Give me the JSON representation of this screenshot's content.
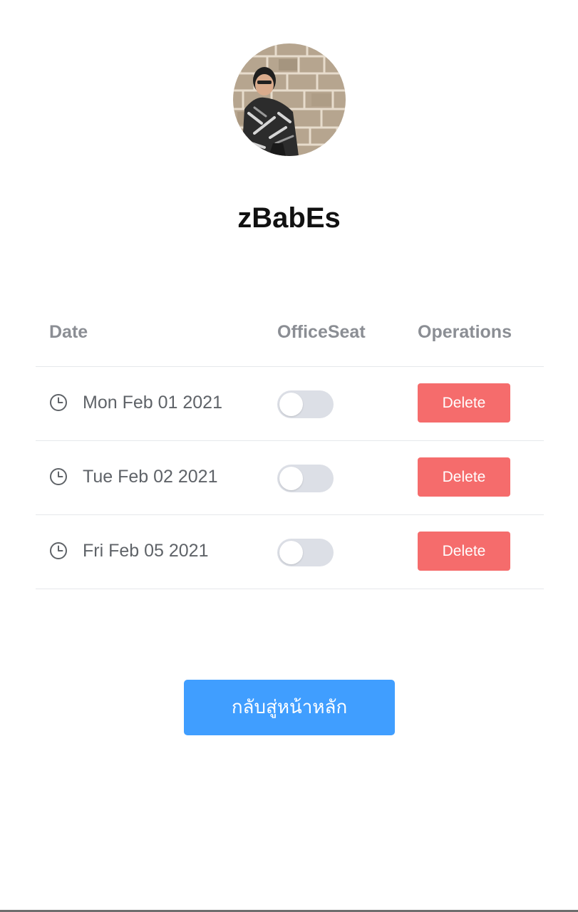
{
  "profile": {
    "username": "zBabEs",
    "avatar": "profile-photo"
  },
  "table": {
    "headers": {
      "date": "Date",
      "office_seat": "OfficeSeat",
      "operations": "Operations"
    },
    "rows": [
      {
        "date": "Mon Feb 01 2021",
        "office_seat": false,
        "action": "Delete"
      },
      {
        "date": "Tue Feb 02 2021",
        "office_seat": false,
        "action": "Delete"
      },
      {
        "date": "Fri Feb 05 2021",
        "office_seat": false,
        "action": "Delete"
      }
    ]
  },
  "home_button": {
    "label": "กลับสู่หน้าหลัก"
  },
  "icons": {
    "row_icon": "clock-icon"
  },
  "colors": {
    "delete": "#f56c6c",
    "primary": "#409eff",
    "switch_off": "#dcdfe6",
    "header_text": "#8b8e94",
    "body_text": "#5f6368"
  }
}
